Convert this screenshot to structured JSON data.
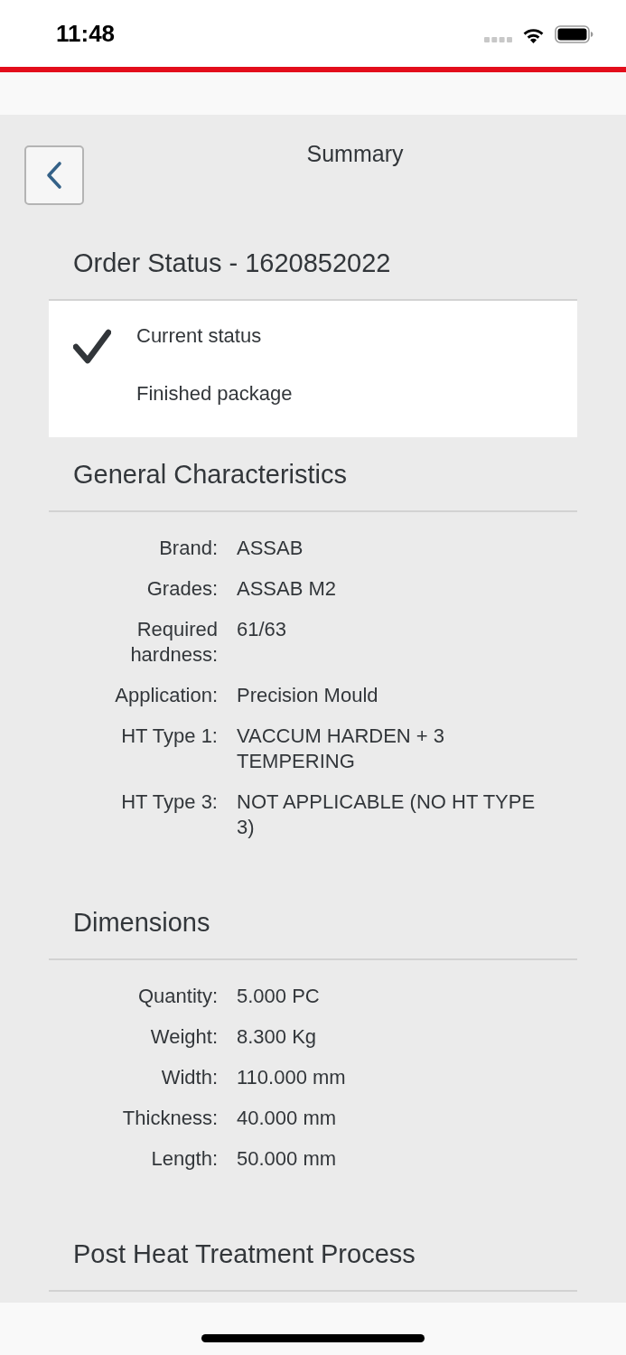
{
  "status_bar": {
    "time": "11:48"
  },
  "header": {
    "title": "Summary"
  },
  "order_status": {
    "title": "Order Status - 1620852022",
    "label": "Current status",
    "value": "Finished package"
  },
  "sections": [
    {
      "title": "General Characteristics",
      "fields": [
        {
          "label": "Brand:",
          "value": "ASSAB"
        },
        {
          "label": "Grades:",
          "value": "ASSAB M2"
        },
        {
          "label": "Required hardness:",
          "value": "61/63"
        },
        {
          "label": "Application:",
          "value": "Precision Mould"
        },
        {
          "label": "HT Type 1:",
          "value": "VACCUM HARDEN + 3 TEMPERING"
        },
        {
          "label": "HT Type 3:",
          "value": "NOT APPLICABLE (NO HT TYPE 3)"
        }
      ]
    },
    {
      "title": "Dimensions",
      "fields": [
        {
          "label": "Quantity:",
          "value": "5.000 PC"
        },
        {
          "label": "Weight:",
          "value": "8.300 Kg"
        },
        {
          "label": "Width:",
          "value": "110.000 mm"
        },
        {
          "label": "Thickness:",
          "value": "40.000 mm"
        },
        {
          "label": "Length:",
          "value": "50.000 mm"
        }
      ]
    },
    {
      "title": "Post Heat Treatment Process"
    }
  ]
}
